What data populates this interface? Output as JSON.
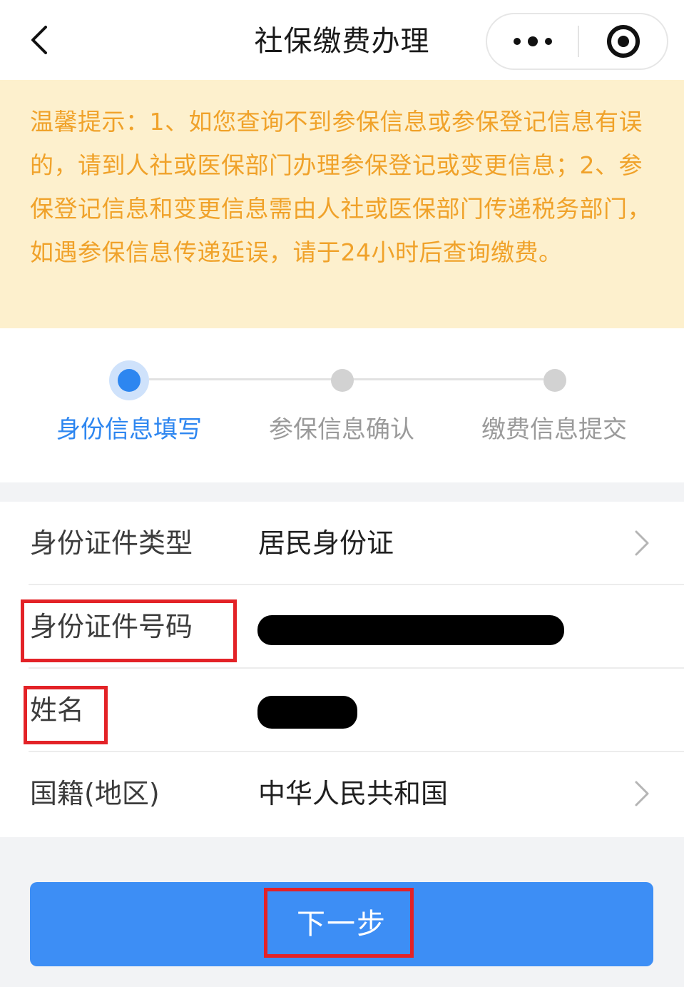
{
  "header": {
    "title": "社保缴费办理",
    "back_icon": "chevron-left-icon",
    "more_icon": "more-dots-icon",
    "close_icon": "target-close-icon"
  },
  "notice": {
    "text": "温馨提示：1、如您查询不到参保信息或参保登记信息有误的，请到人社或医保部门办理参保登记或变更信息；2、参保登记信息和变更信息需由人社或医保部门传递税务部门，如遇参保信息传递延误，请于24小时后查询缴费。",
    "color": "#f0a22a",
    "background": "#fdf0cd"
  },
  "steps": [
    {
      "label": "身份信息填写",
      "active": true
    },
    {
      "label": "参保信息确认",
      "active": false
    },
    {
      "label": "缴费信息提交",
      "active": false
    }
  ],
  "form": {
    "id_type": {
      "label": "身份证件类型",
      "value": "居民身份证"
    },
    "id_number": {
      "label": "身份证件号码"
    },
    "name": {
      "label": "姓名"
    },
    "nationality": {
      "label": "国籍(地区)",
      "value": "中华人民共和国"
    }
  },
  "next_button": {
    "label": "下一步",
    "color": "#3d8ef5"
  },
  "accent_color": "#2d86f0",
  "highlight_color": "#e32227"
}
